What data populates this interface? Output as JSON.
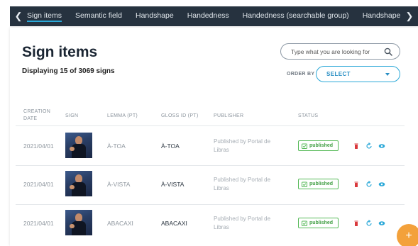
{
  "nav": {
    "tabs": [
      {
        "label": "Sign items",
        "active": true
      },
      {
        "label": "Semantic field"
      },
      {
        "label": "Handshape"
      },
      {
        "label": "Handedness"
      },
      {
        "label": "Handedness (searchable group)"
      },
      {
        "label": "Handshape"
      }
    ],
    "prev_icon": "chevron-left-icon",
    "next_icon": "chevron-right-icon"
  },
  "page": {
    "title": "Sign items",
    "subtitle": "Displaying 15 of 3069 signs"
  },
  "search": {
    "placeholder": "Type what you are looking for",
    "icon": "search-icon"
  },
  "order_by": {
    "label": "ORDER BY",
    "selected": "SELECT"
  },
  "table": {
    "headers": {
      "creation_date_line1": "CREATION",
      "creation_date_line2": "DATE",
      "sign": "SIGN",
      "lemma": "LEMMA (PT)",
      "gloss": "GLOSS ID (PT)",
      "publisher": "PUBLISHER",
      "status": "STATUS"
    },
    "rows": [
      {
        "date": "2021/04/01",
        "lemma": "À-TOA",
        "gloss": "À-TOA",
        "publisher": "Published by Portal de Libras",
        "status": "published"
      },
      {
        "date": "2021/04/01",
        "lemma": "À-VISTA",
        "gloss": "À-VISTA",
        "publisher": "Published by Portal de Libras",
        "status": "published"
      },
      {
        "date": "2021/04/01",
        "lemma": "ABACAXI",
        "gloss": "ABACAXI",
        "publisher": "Published by Portal de Libras",
        "status": "published"
      }
    ]
  },
  "colors": {
    "nav_bg": "#26323f",
    "accent": "#2aa8d8",
    "status_green": "#55b957",
    "delete_red": "#d9383c",
    "fab": "#f3a13b"
  },
  "fab": {
    "label": "+"
  }
}
